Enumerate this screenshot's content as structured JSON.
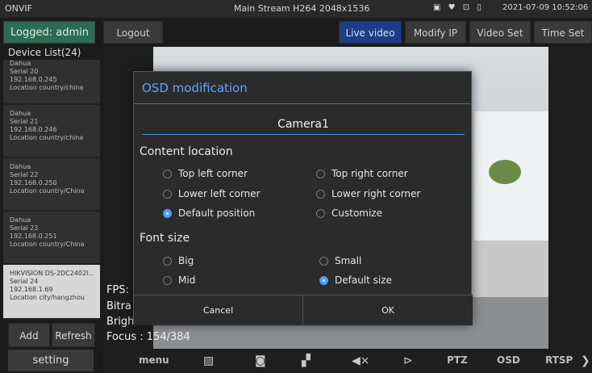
{
  "status": {
    "app": "ONVIF",
    "stream": "Main Stream H264 2048x1536",
    "icons": [
      "card-icon",
      "location-icon",
      "signal-icon",
      "battery-icon"
    ],
    "icons_glyph": "▣ ♥ ⊡ ▯",
    "time": "2021-07-09 10:52:06 ×"
  },
  "topbar": {
    "logged": "Logged: admin",
    "logout": "Logout",
    "live_video": "Live video",
    "modify_ip": "Modify IP",
    "video_set": "Video Set",
    "time_set": "Time Set"
  },
  "devices": {
    "title": "Device List(24)",
    "items": [
      {
        "brand": "Dahua",
        "serial": "Serial 20",
        "ip": "192.168.0.245",
        "location": "Location country/china"
      },
      {
        "brand": "Dahua",
        "serial": "Serial 21",
        "ip": "192.168.0.246",
        "location": "Location country/china"
      },
      {
        "brand": "Dahua",
        "serial": "Serial 22",
        "ip": "192.168.0.250",
        "location": "Location country/China"
      },
      {
        "brand": "Dahua",
        "serial": "Serial 23",
        "ip": "192.168.0.251",
        "location": "Location country/China"
      },
      {
        "brand": "HIKVISION DS-2DC2402I...",
        "serial": "Serial 24",
        "ip": "192.168.1.69",
        "location": "Location city/hangzhou"
      }
    ],
    "add": "Add",
    "refresh": "Refresh",
    "setting": "setting"
  },
  "overlay": {
    "fps": "FPS:",
    "bitrate": "Bitra",
    "bright": "Brigh",
    "focus": "Focus : 154/384"
  },
  "dialog": {
    "title": "OSD modification",
    "name_value": "Camera1",
    "content_location": "Content location",
    "loc_top_left": "Top left corner",
    "loc_top_right": "Top right corner",
    "loc_lower_left": "Lower left corner",
    "loc_lower_right": "Lower right corner",
    "loc_default": "Default position",
    "loc_customize": "Customize",
    "font_size": "Font size",
    "fs_big": "Big",
    "fs_small": "Small",
    "fs_mid": "Mid",
    "fs_default": "Default size",
    "cancel": "Cancel",
    "ok": "OK"
  },
  "toolbar": {
    "menu": "menu",
    "ptz": "PTZ",
    "osd": "OSD",
    "rtsp": "RTSP",
    "icons": [
      "image-icon",
      "camera-icon",
      "record-icon",
      "mute-icon",
      "play-icon",
      "chevron-right-icon"
    ],
    "glyph_image": "▨",
    "glyph_camera": "◙",
    "glyph_record": "▞",
    "glyph_mute": "◀×",
    "glyph_play": "⊳",
    "glyph_chevron": "❯"
  }
}
